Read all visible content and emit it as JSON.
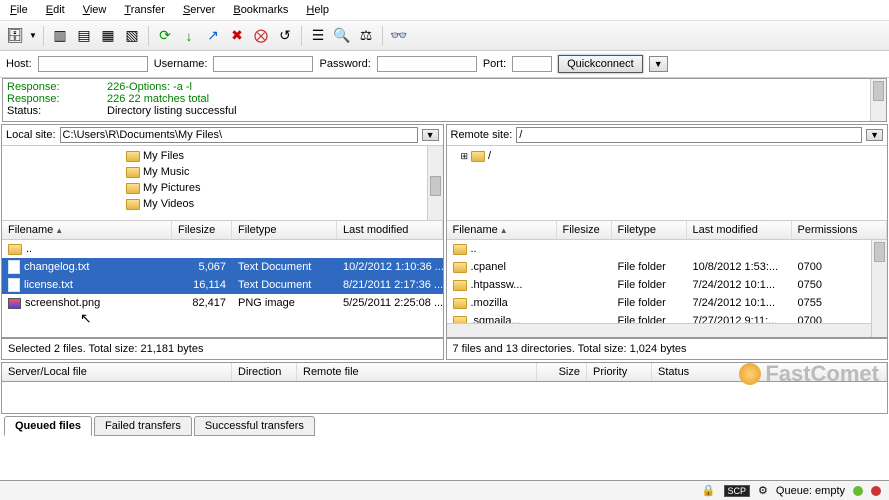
{
  "menu": [
    "File",
    "Edit",
    "View",
    "Transfer",
    "Server",
    "Bookmarks",
    "Help"
  ],
  "toolbar_icons": [
    "site-manager-icon",
    "layout1-icon",
    "layout2-icon",
    "layout3-icon",
    "layout4-icon",
    "refresh-icon",
    "download-icon",
    "upload-icon",
    "cancel-icon",
    "delete-icon",
    "reconnect-icon",
    "filter-icon",
    "search-icon",
    "compare-icon",
    "binoculars-icon"
  ],
  "quickbar": {
    "host_label": "Host:",
    "user_label": "Username:",
    "pass_label": "Password:",
    "port_label": "Port:",
    "connect_label": "Quickconnect"
  },
  "log": [
    {
      "label": "Response:",
      "msg": "226-Options: -a -l",
      "css": "g"
    },
    {
      "label": "Response:",
      "msg": "226 22 matches total",
      "css": "g"
    },
    {
      "label": "Status:",
      "msg": "Directory listing successful",
      "css": ""
    }
  ],
  "local": {
    "label": "Local site:",
    "path": "C:\\Users\\R\\Documents\\My Files\\",
    "tree": [
      "My Files",
      "My Music",
      "My Pictures",
      "My Videos"
    ],
    "headers": [
      "Filename",
      "Filesize",
      "Filetype",
      "Last modified"
    ],
    "rows": [
      {
        "name": "..",
        "size": "",
        "type": "",
        "date": "",
        "icon": "folder",
        "sel": false
      },
      {
        "name": "changelog.txt",
        "size": "5,067",
        "type": "Text Document",
        "date": "10/2/2012 1:10:36 ...",
        "icon": "file",
        "sel": true
      },
      {
        "name": "license.txt",
        "size": "16,114",
        "type": "Text Document",
        "date": "8/21/2011 2:17:36 ...",
        "icon": "file",
        "sel": true
      },
      {
        "name": "screenshot.png",
        "size": "82,417",
        "type": "PNG image",
        "date": "5/25/2011 2:25:08 ...",
        "icon": "image",
        "sel": false
      }
    ],
    "status": "Selected 2 files. Total size: 21,181 bytes"
  },
  "remote": {
    "label": "Remote site:",
    "path": "/",
    "tree": [
      "/"
    ],
    "headers": [
      "Filename",
      "Filesize",
      "Filetype",
      "Last modified",
      "Permissions"
    ],
    "rows": [
      {
        "name": "..",
        "size": "",
        "type": "",
        "date": "",
        "perm": ""
      },
      {
        "name": ".cpanel",
        "size": "",
        "type": "File folder",
        "date": "10/8/2012 1:53:...",
        "perm": "0700"
      },
      {
        "name": ".htpassw...",
        "size": "",
        "type": "File folder",
        "date": "7/24/2012 10:1...",
        "perm": "0750"
      },
      {
        "name": ".mozilla",
        "size": "",
        "type": "File folder",
        "date": "7/24/2012 10:1...",
        "perm": "0755"
      },
      {
        "name": ".sqmaila...",
        "size": "",
        "type": "File folder",
        "date": "7/27/2012 9:11:...",
        "perm": "0700"
      }
    ],
    "status": "7 files and 13 directories. Total size: 1,024 bytes"
  },
  "transfer_headers": {
    "file": "Server/Local file",
    "dir": "Direction",
    "remote": "Remote file",
    "size": "Size",
    "prio": "Priority",
    "status": "Status"
  },
  "tabs": {
    "queued": "Queued files",
    "failed": "Failed transfers",
    "success": "Successful transfers"
  },
  "footer": {
    "queue": "Queue: empty"
  },
  "branding": "FastComet"
}
